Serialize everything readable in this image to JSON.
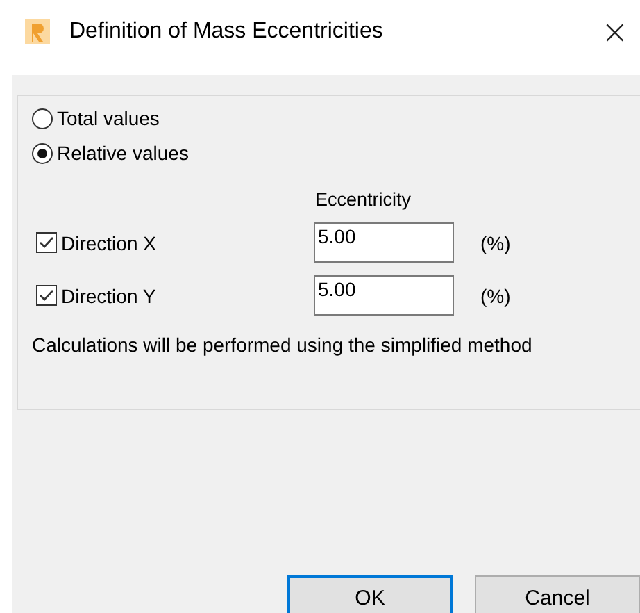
{
  "window": {
    "title": "Definition of Mass Eccentricities",
    "close": "×"
  },
  "mode_options": [
    {
      "label": "Total values",
      "selected": false
    },
    {
      "label": "Relative values",
      "selected": true
    }
  ],
  "column_header": "Eccentricity",
  "directions": [
    {
      "label": "Direction X",
      "checked": true,
      "value": "5.00",
      "unit": "(%)"
    },
    {
      "label": "Direction Y",
      "checked": true,
      "value": "5.00",
      "unit": "(%)"
    }
  ],
  "note": "Calculations will be performed using the simplified method",
  "buttons": [
    {
      "label": "OK",
      "default": true
    },
    {
      "label": "Cancel",
      "default": false
    }
  ]
}
